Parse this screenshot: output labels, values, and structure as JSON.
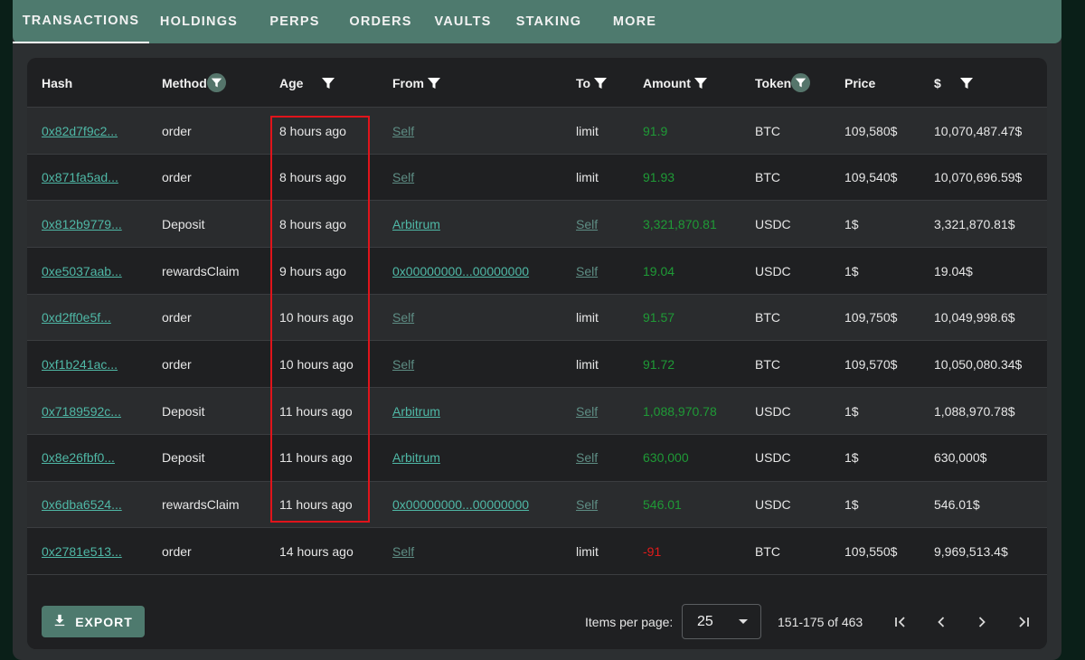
{
  "tabs": [
    {
      "label": "TRANSACTIONS",
      "active": true
    },
    {
      "label": "HOLDINGS",
      "active": false
    },
    {
      "label": "PERPS",
      "active": false
    },
    {
      "label": "ORDERS",
      "active": false
    },
    {
      "label": "VAULTS",
      "active": false
    },
    {
      "label": "STAKING",
      "active": false
    },
    {
      "label": "MORE",
      "active": false
    }
  ],
  "table": {
    "columns": [
      {
        "label": "Hash",
        "filter": "none"
      },
      {
        "label": "Method",
        "filter": "circle"
      },
      {
        "label": "Age",
        "filter": "plain"
      },
      {
        "label": "From",
        "filter": "plain"
      },
      {
        "label": "To",
        "filter": "plain"
      },
      {
        "label": "Amount",
        "filter": "plain"
      },
      {
        "label": "Token",
        "filter": "circle"
      },
      {
        "label": "Price",
        "filter": "none"
      },
      {
        "label": "$",
        "filter": "plain"
      }
    ],
    "rows": [
      {
        "hash": "0x82d7f9c2...",
        "method": "order",
        "age": "8 hours ago",
        "from": "Self",
        "to": "limit",
        "amount": "91.9",
        "amount_sign": "positive",
        "token": "BTC",
        "price": "109,580$",
        "usd": "10,070,487.47$"
      },
      {
        "hash": "0x871fa5ad...",
        "method": "order",
        "age": "8 hours ago",
        "from": "Self",
        "to": "limit",
        "amount": "91.93",
        "amount_sign": "positive",
        "token": "BTC",
        "price": "109,540$",
        "usd": "10,070,696.59$"
      },
      {
        "hash": "0x812b9779...",
        "method": "Deposit",
        "age": "8 hours ago",
        "from": "Arbitrum",
        "to": "Self",
        "amount": "3,321,870.81",
        "amount_sign": "positive",
        "token": "USDC",
        "price": "1$",
        "usd": "3,321,870.81$"
      },
      {
        "hash": "0xe5037aab...",
        "method": "rewardsClaim",
        "age": "9 hours ago",
        "from": "0x00000000...00000000",
        "to": "Self",
        "amount": "19.04",
        "amount_sign": "positive",
        "token": "USDC",
        "price": "1$",
        "usd": "19.04$"
      },
      {
        "hash": "0xd2ff0e5f...",
        "method": "order",
        "age": "10 hours ago",
        "from": "Self",
        "to": "limit",
        "amount": "91.57",
        "amount_sign": "positive",
        "token": "BTC",
        "price": "109,750$",
        "usd": "10,049,998.6$"
      },
      {
        "hash": "0xf1b241ac...",
        "method": "order",
        "age": "10 hours ago",
        "from": "Self",
        "to": "limit",
        "amount": "91.72",
        "amount_sign": "positive",
        "token": "BTC",
        "price": "109,570$",
        "usd": "10,050,080.34$"
      },
      {
        "hash": "0x7189592c...",
        "method": "Deposit",
        "age": "11 hours ago",
        "from": "Arbitrum",
        "to": "Self",
        "amount": "1,088,970.78",
        "amount_sign": "positive",
        "token": "USDC",
        "price": "1$",
        "usd": "1,088,970.78$"
      },
      {
        "hash": "0x8e26fbf0...",
        "method": "Deposit",
        "age": "11 hours ago",
        "from": "Arbitrum",
        "to": "Self",
        "amount": "630,000",
        "amount_sign": "positive",
        "token": "USDC",
        "price": "1$",
        "usd": "630,000$"
      },
      {
        "hash": "0x6dba6524...",
        "method": "rewardsClaim",
        "age": "11 hours ago",
        "from": "0x00000000...00000000",
        "to": "Self",
        "amount": "546.01",
        "amount_sign": "positive",
        "token": "USDC",
        "price": "1$",
        "usd": "546.01$"
      },
      {
        "hash": "0x2781e513...",
        "method": "order",
        "age": "14 hours ago",
        "from": "Self",
        "to": "limit",
        "amount": "-91",
        "amount_sign": "negative",
        "token": "BTC",
        "price": "109,550$",
        "usd": "9,969,513.4$"
      }
    ]
  },
  "footer": {
    "export_label": "EXPORT",
    "items_per_page_label": "Items per page:",
    "items_per_page_value": "25",
    "range_text": "151-175 of 463"
  },
  "colors": {
    "tab_bar": "#4e7a6e",
    "link": "#4fb8a6",
    "positive": "#1f9a36",
    "negative": "#e01b1b",
    "highlight_box": "#e0141b"
  }
}
